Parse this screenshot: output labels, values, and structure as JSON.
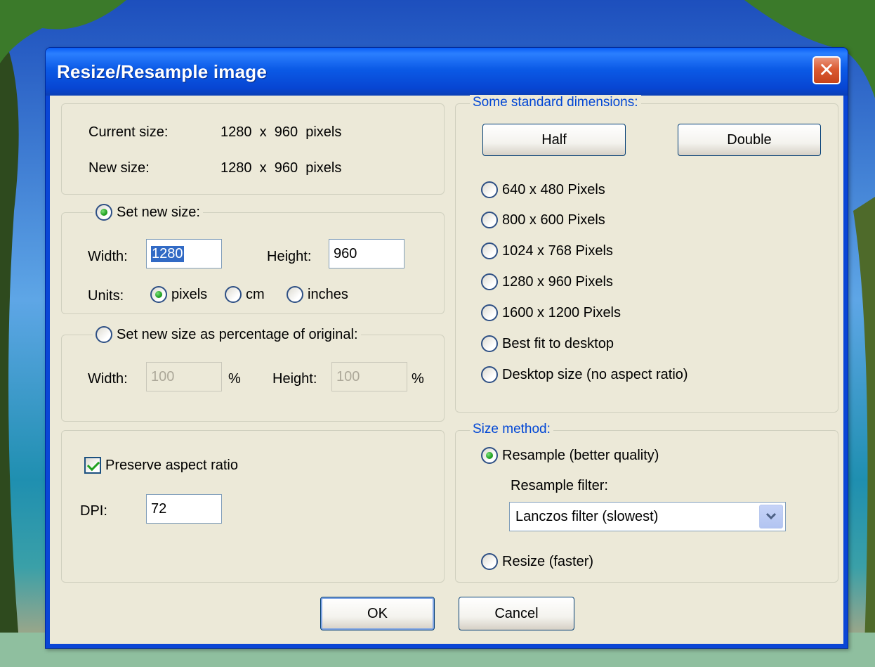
{
  "dialog": {
    "title": "Resize/Resample image",
    "close_glyph": "✕"
  },
  "size_info": {
    "current_label": "Current size:",
    "current_value": "1280  x  960  pixels",
    "new_label": "New size:",
    "new_value": "1280  x  960  pixels"
  },
  "set_new_size": {
    "legend": "Set new size:",
    "selected": true,
    "width_label": "Width:",
    "width_value": "1280",
    "height_label": "Height:",
    "height_value": "960",
    "units_label": "Units:",
    "units": [
      {
        "label": "pixels",
        "selected": true
      },
      {
        "label": "cm",
        "selected": false
      },
      {
        "label": "inches",
        "selected": false
      }
    ]
  },
  "percentage": {
    "legend": "Set new size as percentage of original:",
    "selected": false,
    "width_label": "Width:",
    "width_value": "100",
    "height_label": "Height:",
    "height_value": "100",
    "unit": "%"
  },
  "aspect": {
    "preserve_label": "Preserve aspect ratio",
    "preserve_checked": true,
    "dpi_label": "DPI:",
    "dpi_value": "72"
  },
  "standard": {
    "legend": "Some standard dimensions:",
    "half_label": "Half",
    "double_label": "Double",
    "options": [
      "640 x 480 Pixels",
      "800 x 600 Pixels",
      "1024 x 768 Pixels",
      "1280 x 960 Pixels",
      "1600 x 1200 Pixels",
      "Best fit to desktop",
      "Desktop size (no aspect ratio)"
    ]
  },
  "method": {
    "legend": "Size method:",
    "resample_label": "Resample (better quality)",
    "resample_selected": true,
    "filter_label": "Resample filter:",
    "filter_value": "Lanczos filter (slowest)",
    "resize_label": "Resize (faster)",
    "resize_selected": false
  },
  "footer": {
    "ok_label": "OK",
    "cancel_label": "Cancel"
  },
  "colors": {
    "title_bar": "#0a5ae6",
    "dialog_face": "#ece9d8",
    "group_legend": "#0046d5",
    "radio_dot": "#21a121"
  },
  "icons": {
    "close": "close-icon",
    "dropdown": "chevron-down-icon"
  }
}
